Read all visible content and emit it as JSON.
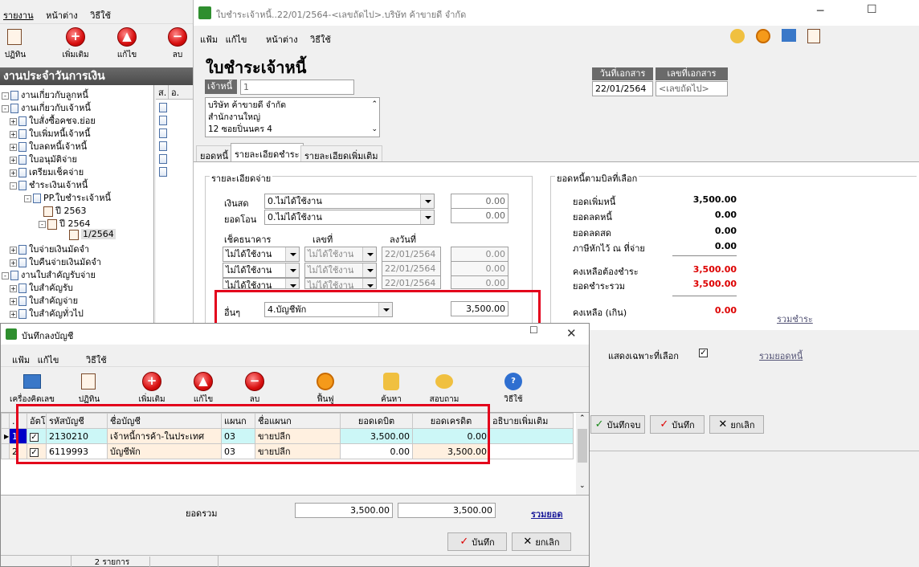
{
  "main_window": {
    "menu": [
      "รายงาน",
      "หน้าต่าง",
      "วิธีใช้"
    ],
    "toolbar": [
      "ปฏิทิน",
      "เพิ่มเติม",
      "แก้ไข",
      "ลบ"
    ],
    "panel_title": "งานประจำวันการเงิน",
    "tree": [
      "งานเกี่ยวกับลูกหนี้",
      "งานเกี่ยวกับเจ้าหนี้",
      "ใบสั่งซื้อคชจ.ย่อย",
      "ใบเพิ่มหนี้เจ้าหนี้",
      "ใบลดหนี้เจ้าหนี้",
      "ใบอนุมัติจ่าย",
      "เตรียมเช็คจ่าย",
      "ชำระเงินเจ้าหนี้",
      "PP.ใบชำระเจ้าหนี้",
      "ปี 2563",
      "ปี 2564",
      "1/2564",
      "ใบจ่ายเงินมัดจำ",
      "ใบคืนจ่ายเงินมัดจำ",
      "งานใบสำคัญรับจ่าย",
      "ใบสำคัญรับ",
      "ใบสำคัญจ่าย",
      "ใบสำคัญทั่วไป"
    ],
    "list_headers": [
      "ส.",
      "อ."
    ]
  },
  "payment_window": {
    "title": "ใบชำระเจ้าหนี้..22/01/2564-<เลขถัดไป>.บริษัท ค้าขายดี จำกัด",
    "menu": [
      "แฟ้ม",
      "แก้ไข",
      "หน้าต่าง",
      "วิธีใช้"
    ],
    "heading": "ใบชำระเจ้าหนี้",
    "creditor_label": "เจ้าหนี้",
    "creditor_value": "1",
    "address": [
      "บริษัท ค้าขายดี จำกัด",
      "สำนักงานใหญ่",
      "12 ซอยปิ่นนคร 4"
    ],
    "doc_date_label": "วันที่เอกสาร",
    "doc_date": "22/01/2564",
    "doc_no_label": "เลขที่เอกสาร",
    "doc_no": "<เลขถัดไป>",
    "tabs": [
      "ยอดหนี้",
      "รายละเอียดชำระ",
      "รายละเอียดเพิ่มเติม"
    ],
    "pay_group": "รายละเอียดจ่าย",
    "cash_label": "เงินสด",
    "cash_mode": "0.ไม่ได้ใช้งาน",
    "cash_amount": "0.00",
    "transfer_label": "ยอดโอน",
    "transfer_mode": "0.ไม่ได้ใช้งาน",
    "transfer_amount": "0.00",
    "cheque_headers": [
      "เช็คธนาคาร",
      "เลขที่",
      "ลงวันที่"
    ],
    "cheques": [
      {
        "bank": "ไม่ได้ใช้งาน",
        "no": "ไม่ได้ใช้งาน",
        "date": "22/01/2564",
        "amount": "0.00"
      },
      {
        "bank": "ไม่ได้ใช้งาน",
        "no": "ไม่ได้ใช้งาน",
        "date": "22/01/2564",
        "amount": "0.00"
      },
      {
        "bank": "ไม่ได้ใช้งาน",
        "no": "ไม่ได้ใช้งาน",
        "date": "22/01/2564",
        "amount": "0.00"
      }
    ],
    "other_label": "อื่นๆ",
    "other_mode": "4.บัญชีพัก",
    "other_amount": "3,500.00",
    "summary_group": "ยอดหนี้ตามบิลที่เลือก",
    "summary": [
      {
        "label": "ยอดเพิ่มหนี้",
        "value": "3,500.00"
      },
      {
        "label": "ยอดลดหนี้",
        "value": "0.00"
      },
      {
        "label": "ยอดลดสด",
        "value": "0.00"
      },
      {
        "label": "ภาษีหักไว้ ณ ที่จ่าย",
        "value": "0.00"
      },
      {
        "label": "คงเหลือต้องชำระ",
        "value": "3,500.00"
      },
      {
        "label": "ยอดชำระรวม",
        "value": "3,500.00"
      },
      {
        "label": "คงเหลือ (เกิน)",
        "value": "0.00"
      }
    ],
    "total_link": "รวมชำระ",
    "show_selected_label": "แสดงเฉพาะที่เลือก",
    "sum_debt_link": "รวมยอดหนี้",
    "buttons": [
      "บันทึกจบ",
      "บันทึก",
      "ยกเลิก"
    ]
  },
  "journal_window": {
    "title": "บันทึกลงบัญชี",
    "menu": [
      "แฟ้ม",
      "แก้ไข",
      "วิธีใช้"
    ],
    "toolbar": [
      "เครื่องคิดเลข",
      "ปฏิทิน",
      "เพิ่มเติม",
      "แก้ไข",
      "ลบ",
      "ฟื้นฟู",
      "ค้นหา",
      "สอบถาม",
      "วิธีใช้"
    ],
    "columns": [
      ".",
      "อัตโนมั",
      "รหัสบัญชี",
      "ชื่อบัญชี",
      "แผนก",
      "ชื่อแผนก",
      "ยอดเดบิต",
      "ยอดเครดิต",
      "อธิบายเพิ่มเติม"
    ],
    "rows": [
      {
        "n": "1",
        "code": "2130210",
        "name": "เจ้าหนี้การค้า-ในประเทศ",
        "dept": "03",
        "dept_name": "ขายปลีก",
        "debit": "3,500.00",
        "credit": "0.00"
      },
      {
        "n": "2",
        "code": "6119993",
        "name": "บัญชีพัก",
        "dept": "03",
        "dept_name": "ขายปลีก",
        "debit": "0.00",
        "credit": "3,500.00"
      }
    ],
    "total_label": "ยอดรวม",
    "total_debit": "3,500.00",
    "total_credit": "3,500.00",
    "sum_link": "รวมยอด",
    "save": "บันทึก",
    "cancel": "ยกเลิก",
    "status": "2 รายการ"
  }
}
